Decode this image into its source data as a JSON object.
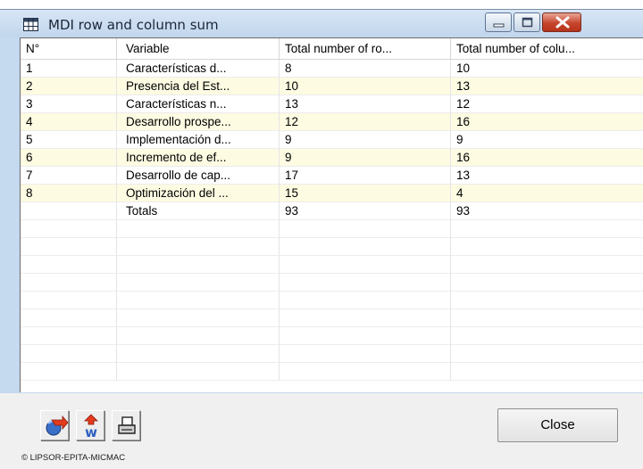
{
  "window": {
    "title": "MDI row and column sum",
    "icon": "grid-icon"
  },
  "table": {
    "headers": [
      "N°",
      "Variable",
      "Total number of ro...",
      "Total number of colu..."
    ],
    "rows": [
      [
        "1",
        "Características d...",
        "8",
        "10"
      ],
      [
        "2",
        "Presencia del Est...",
        "10",
        "13"
      ],
      [
        "3",
        "Características n...",
        "13",
        "12"
      ],
      [
        "4",
        "Desarrollo prospe...",
        "12",
        "16"
      ],
      [
        "5",
        "Implementación d...",
        "9",
        "9"
      ],
      [
        "6",
        "Incremento de ef...",
        "9",
        "16"
      ],
      [
        "7",
        "Desarrollo de cap...",
        "17",
        "13"
      ],
      [
        "8",
        "Optimización del ...",
        "15",
        "4"
      ],
      [
        "",
        "Totals",
        "93",
        "93"
      ]
    ],
    "alt_row_color": "#fdfbe2"
  },
  "toolbar": {
    "buttons": [
      {
        "icon": "copy-to-clipboard-icon"
      },
      {
        "icon": "export-word-icon"
      },
      {
        "icon": "printer-icon"
      }
    ],
    "close_label": "Close"
  },
  "footer": {
    "copyright": "© LIPSOR-EPITA-MICMAC"
  }
}
